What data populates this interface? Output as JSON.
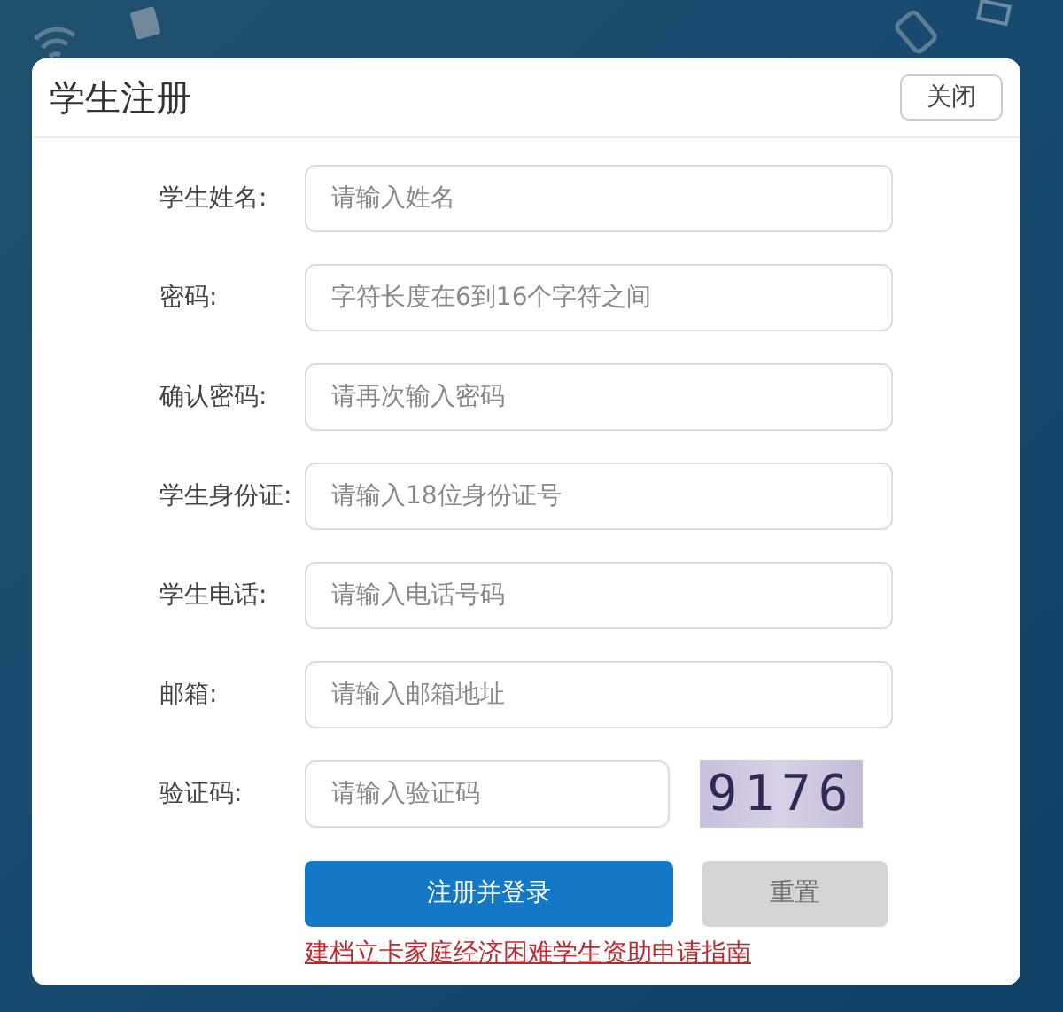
{
  "dialog": {
    "title": "学生注册",
    "close_button": "关闭"
  },
  "fields": [
    {
      "label": "学生姓名:",
      "placeholder": "请输入姓名"
    },
    {
      "label": "密码:",
      "placeholder": "字符长度在6到16个字符之间"
    },
    {
      "label": "确认密码:",
      "placeholder": "请再次输入密码"
    },
    {
      "label": "学生身份证:",
      "placeholder": "请输入18位身份证号"
    },
    {
      "label": "学生电话:",
      "placeholder": "请输入电话号码"
    },
    {
      "label": "邮箱:",
      "placeholder": "请输入邮箱地址"
    }
  ],
  "captcha": {
    "label": "验证码:",
    "placeholder": "请输入验证码",
    "code": "9176"
  },
  "buttons": [
    {
      "label": "注册并登录",
      "disabled": false
    },
    {
      "label": "重置",
      "disabled": true
    }
  ],
  "link": "建档立卡家庭经济困难学生资助申请指南"
}
